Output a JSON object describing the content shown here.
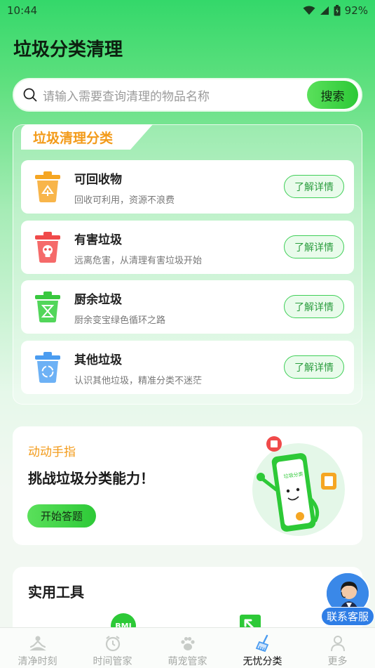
{
  "status": {
    "time": "10:44",
    "battery": "92%"
  },
  "header": {
    "title": "垃圾分类清理"
  },
  "search": {
    "placeholder": "请输入需要查询清理的物品名称",
    "button": "搜索"
  },
  "categories": {
    "title": "垃圾清理分类",
    "items": [
      {
        "name": "可回收物",
        "desc": "回收可利用，资源不浪费",
        "action": "了解详情",
        "icon": "recycle-bin-icon",
        "color": "#f5a623"
      },
      {
        "name": "有害垃圾",
        "desc": "远离危害，从清理有害垃圾开始",
        "action": "了解详情",
        "icon": "hazard-bin-icon",
        "color": "#f04a4a"
      },
      {
        "name": "厨余垃圾",
        "desc": "厨余变宝绿色循环之路",
        "action": "了解详情",
        "icon": "kitchen-bin-icon",
        "color": "#39c83f"
      },
      {
        "name": "其他垃圾",
        "desc": "认识其他垃圾，精准分类不迷茫",
        "action": "了解详情",
        "icon": "other-bin-icon",
        "color": "#4b9cf0"
      }
    ]
  },
  "challenge": {
    "subtitle": "动动手指",
    "title": "挑战垃圾分类能力！",
    "button": "开始答题",
    "phone_text": "垃圾分类"
  },
  "tools": {
    "title": "实用工具",
    "bmi_label": "BMI"
  },
  "support": {
    "label": "联系客服"
  },
  "nav": {
    "items": [
      {
        "label": "清净时刻",
        "icon": "meditation-icon",
        "active": false
      },
      {
        "label": "时间管家",
        "icon": "alarm-clock-icon",
        "active": false
      },
      {
        "label": "萌宠管家",
        "icon": "paw-icon",
        "active": false
      },
      {
        "label": "无忧分类",
        "icon": "broom-icon",
        "active": true
      },
      {
        "label": "更多",
        "icon": "person-icon",
        "active": false
      }
    ]
  },
  "colors": {
    "primary": "#2dc937",
    "accent": "#f39b1a"
  }
}
